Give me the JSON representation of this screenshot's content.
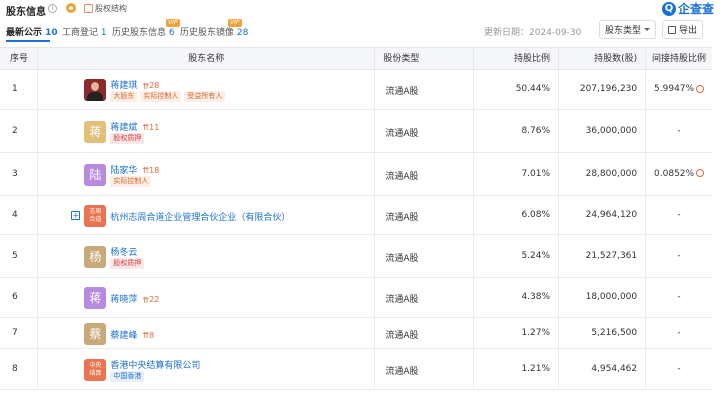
{
  "header": {
    "title": "股东信息",
    "info_glyph": "i",
    "structure_label": "股权结构",
    "logo_text": "企查查",
    "logo_glyph": "Q"
  },
  "tabs": [
    {
      "label": "最新公示",
      "count": "10"
    },
    {
      "label": "工商登记",
      "count": "1"
    },
    {
      "label": "历史股东信息",
      "count": "6",
      "badge": "VIP"
    },
    {
      "label": "历史股东镜像",
      "count": "28",
      "badge": "VIP"
    }
  ],
  "toolbar": {
    "update_label": "更新日期：2024-09-30",
    "type_button": "股东类型",
    "export_button": "导出"
  },
  "table": {
    "headers": [
      "序号",
      "股东名称",
      "股份类型",
      "持股比例",
      "持股数(股)",
      "间接持股比例"
    ],
    "rows": [
      {
        "no": "1",
        "name": "蒋建琪",
        "avatar_char": "",
        "control": "28",
        "tags": [
          {
            "text": "大股东",
            "color": "orange"
          },
          {
            "text": "实际控制人",
            "color": "orange"
          },
          {
            "text": "受益所有人",
            "color": "orange"
          }
        ],
        "type": "流通A股",
        "pct": "50.44%",
        "amount": "207,196,230",
        "indirect": "5.9947%"
      },
      {
        "no": "2",
        "name": "蒋建斌",
        "avatar_char": "蒋",
        "avatar_color": "#e3c07a",
        "control": "11",
        "tags": [
          {
            "text": "股权质押",
            "color": "red"
          }
        ],
        "type": "流通A股",
        "pct": "8.76%",
        "amount": "36,000,000",
        "indirect": "-"
      },
      {
        "no": "3",
        "name": "陆家华",
        "avatar_char": "陆",
        "avatar_color": "#b78ce0",
        "control": "18",
        "tags": [
          {
            "text": "实际控制人",
            "color": "orange"
          }
        ],
        "type": "流通A股",
        "pct": "7.01%",
        "amount": "28,800,000",
        "indirect": "0.0852%"
      },
      {
        "no": "4",
        "name": "杭州志周合道企业管理合伙企业（有限合伙）",
        "avatar_char": "志周\n合道",
        "avatar_color": "#e9744f",
        "control": "",
        "tags": [],
        "type": "流通A股",
        "pct": "6.08%",
        "amount": "24,964,120",
        "indirect": "-"
      },
      {
        "no": "5",
        "name": "杨冬云",
        "avatar_char": "杨",
        "avatar_color": "#c9a97a",
        "control": "",
        "tags": [
          {
            "text": "股权质押",
            "color": "red"
          }
        ],
        "type": "流通A股",
        "pct": "5.24%",
        "amount": "21,527,361",
        "indirect": "-"
      },
      {
        "no": "6",
        "name": "蒋晓萍",
        "avatar_char": "蒋",
        "avatar_color": "#b78ce0",
        "control": "22",
        "tags": [],
        "type": "流通A股",
        "pct": "4.38%",
        "amount": "18,000,000",
        "indirect": "-"
      },
      {
        "no": "7",
        "name": "蔡建峰",
        "avatar_char": "蔡",
        "avatar_color": "#c9a97a",
        "control": "8",
        "tags": [],
        "type": "流通A股",
        "pct": "1.27%",
        "amount": "5,216,500",
        "indirect": "-"
      },
      {
        "no": "8",
        "name": "香港中央结算有限公司",
        "avatar_char": "中央\n结算",
        "avatar_color": "#e9744f",
        "control": "",
        "tags": [
          {
            "text": "中国香港",
            "color": "blue"
          }
        ],
        "type": "流通A股",
        "pct": "1.21%",
        "amount": "4,954,462",
        "indirect": "-"
      }
    ]
  },
  "colors": {
    "accent": "#1b70d8",
    "control_orange": "#e5663b",
    "header_bg": "#f4f6fa"
  }
}
